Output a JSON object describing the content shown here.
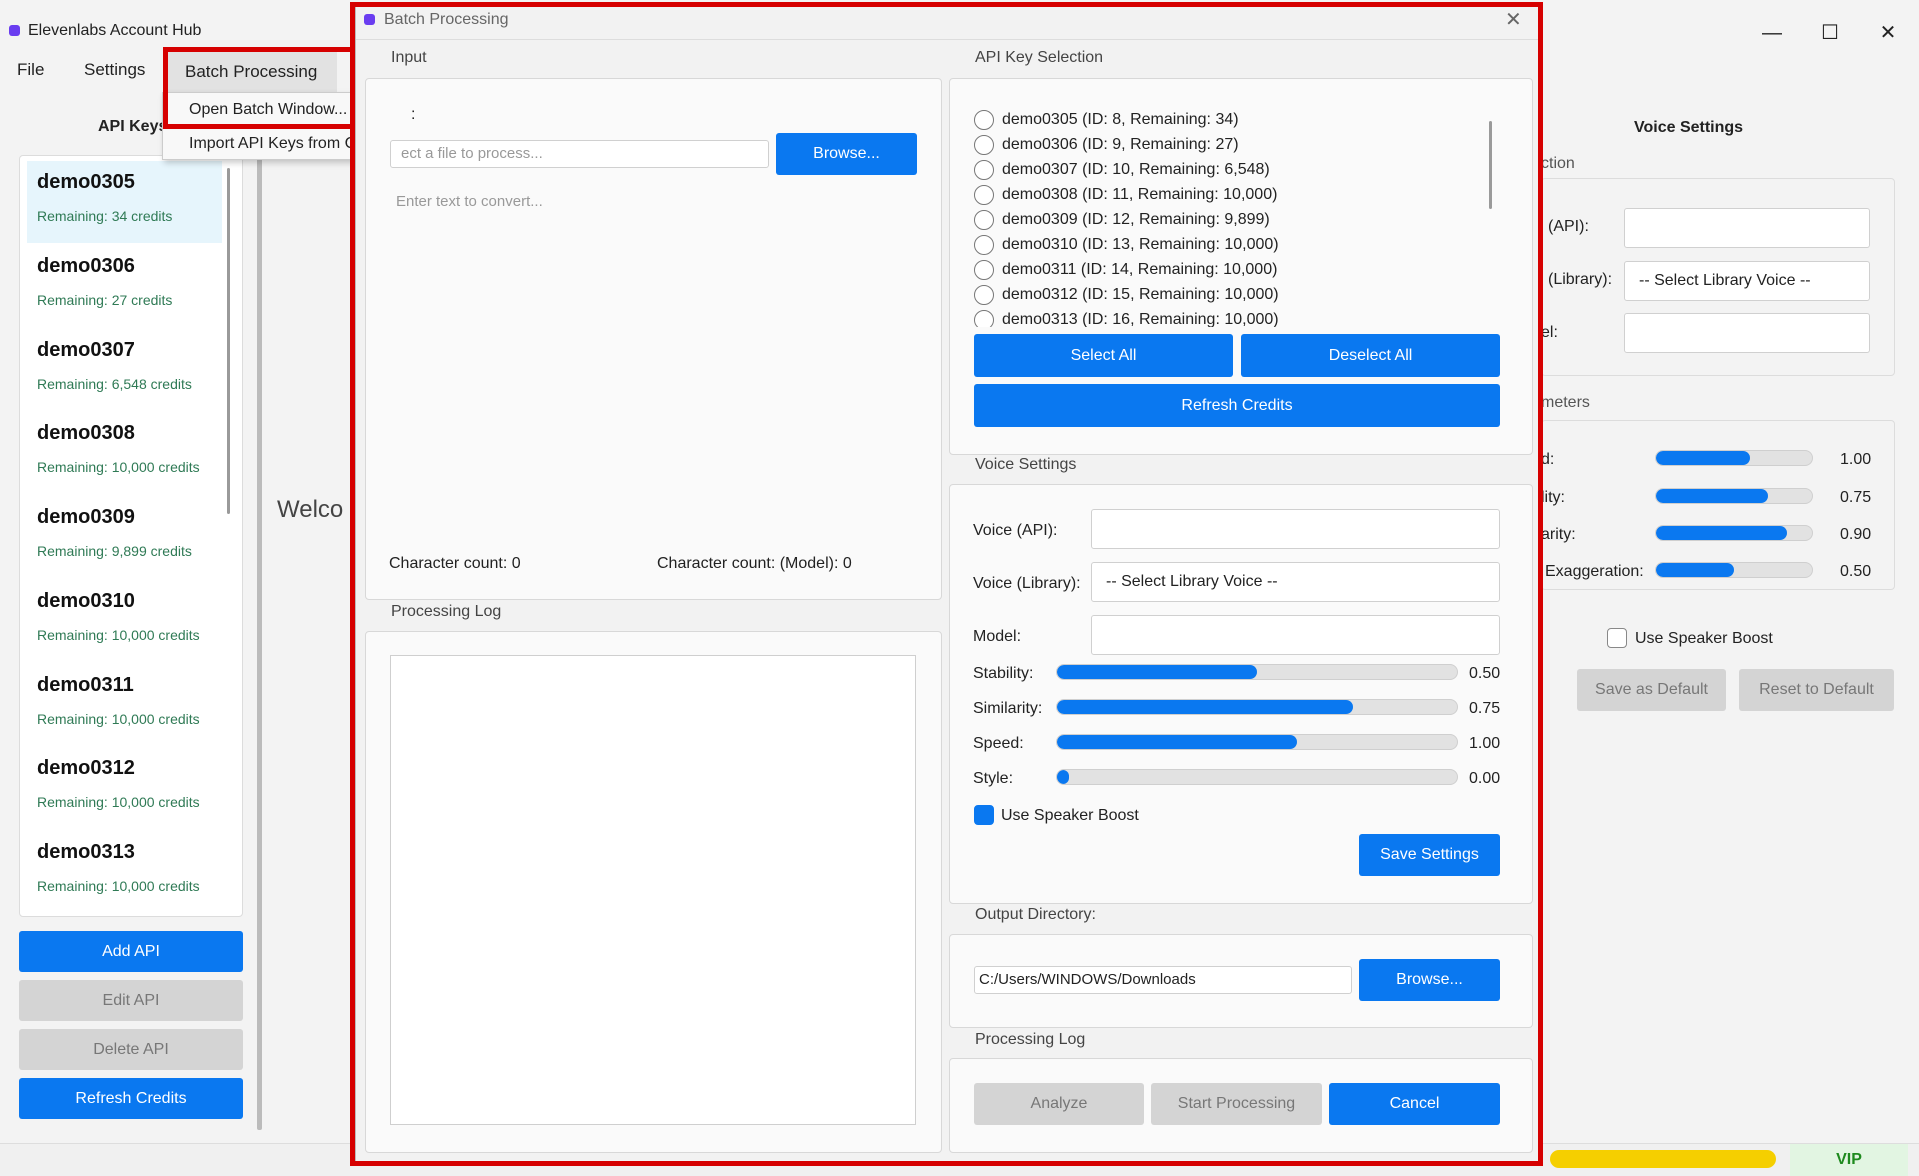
{
  "window": {
    "title": "Elevenlabs Account Hub"
  },
  "menubar": {
    "file": "File",
    "settings": "Settings",
    "batch": "Batch Processing"
  },
  "menu_dropdown": {
    "items": [
      "Open Batch Window...",
      "Import API Keys from CSV..."
    ]
  },
  "left_panel": {
    "title": "API Keys",
    "keys": [
      {
        "name": "demo0305",
        "remaining": "Remaining: 34 credits"
      },
      {
        "name": "demo0306",
        "remaining": "Remaining: 27 credits"
      },
      {
        "name": "demo0307",
        "remaining": "Remaining: 6,548 credits"
      },
      {
        "name": "demo0308",
        "remaining": "Remaining: 10,000 credits"
      },
      {
        "name": "demo0309",
        "remaining": "Remaining: 9,899 credits"
      },
      {
        "name": "demo0310",
        "remaining": "Remaining: 10,000 credits"
      },
      {
        "name": "demo0311",
        "remaining": "Remaining: 10,000 credits"
      },
      {
        "name": "demo0312",
        "remaining": "Remaining: 10,000 credits"
      },
      {
        "name": "demo0313",
        "remaining": "Remaining: 10,000 credits"
      }
    ],
    "buttons": {
      "add": "Add API",
      "edit": "Edit API",
      "delete": "Delete API",
      "refresh": "Refresh Credits"
    }
  },
  "welcome": "Welco",
  "right_panel": {
    "title": "Voice Settings",
    "section1": "ction",
    "voice_api": "(API):",
    "voice_library": "(Library):",
    "library_select": "-- Select Library Voice --",
    "model": "el:",
    "section2": "meters",
    "params": [
      {
        "label": "d:",
        "value": "1.00",
        "fill": 0.6
      },
      {
        "label": "lity:",
        "value": "0.75",
        "fill": 0.72
      },
      {
        "label": "arity:",
        "value": "0.90",
        "fill": 0.84
      },
      {
        "label": "Exaggeration:",
        "value": "0.50",
        "fill": 0.5
      }
    ],
    "speaker_boost": "Use Speaker Boost",
    "save_default": "Save as Default",
    "reset_default": "Reset to Default"
  },
  "status": {
    "vip": "VIP"
  },
  "dialog": {
    "title": "Batch Processing",
    "input_label": "Input",
    "file_label": ":",
    "file_placeholder": "ect a file to process...",
    "browse": "Browse...",
    "text_placeholder": "Enter text to convert...",
    "char_count": "Character count: 0",
    "char_count_model": "Character count: (Model): 0",
    "log_label": "Processing Log",
    "api_key_selection": "API Key Selection",
    "api_keys": [
      "demo0305 (ID: 8, Remaining: 34)",
      "demo0306 (ID: 9, Remaining: 27)",
      "demo0307 (ID: 10, Remaining: 6,548)",
      "demo0308 (ID: 11, Remaining: 10,000)",
      "demo0309 (ID: 12, Remaining: 9,899)",
      "demo0310 (ID: 13, Remaining: 10,000)",
      "demo0311 (ID: 14, Remaining: 10,000)",
      "demo0312 (ID: 15, Remaining: 10,000)",
      "demo0313 (ID: 16, Remaining: 10,000)"
    ],
    "select_all": "Select All",
    "deselect_all": "Deselect All",
    "refresh_credits": "Refresh Credits",
    "voice_settings": "Voice Settings",
    "voice_api": "Voice (API):",
    "voice_library": "Voice (Library):",
    "library_select": "-- Select Library Voice --",
    "model": "Model:",
    "sliders": [
      {
        "label": "Stability:",
        "value": "0.50",
        "fill": 0.5
      },
      {
        "label": "Similarity:",
        "value": "0.75",
        "fill": 0.74
      },
      {
        "label": "Speed:",
        "value": "1.00",
        "fill": 0.6
      },
      {
        "label": "Style:",
        "value": "0.00",
        "fill": 0.03
      }
    ],
    "speaker_boost": "Use Speaker Boost",
    "save_settings": "Save Settings",
    "output_directory": "Output Directory:",
    "output_path": "C:/Users/WINDOWS/Downloads",
    "output_browse": "Browse...",
    "log_label2": "Processing Log",
    "analyze": "Analyze",
    "start": "Start Processing",
    "cancel": "Cancel"
  }
}
